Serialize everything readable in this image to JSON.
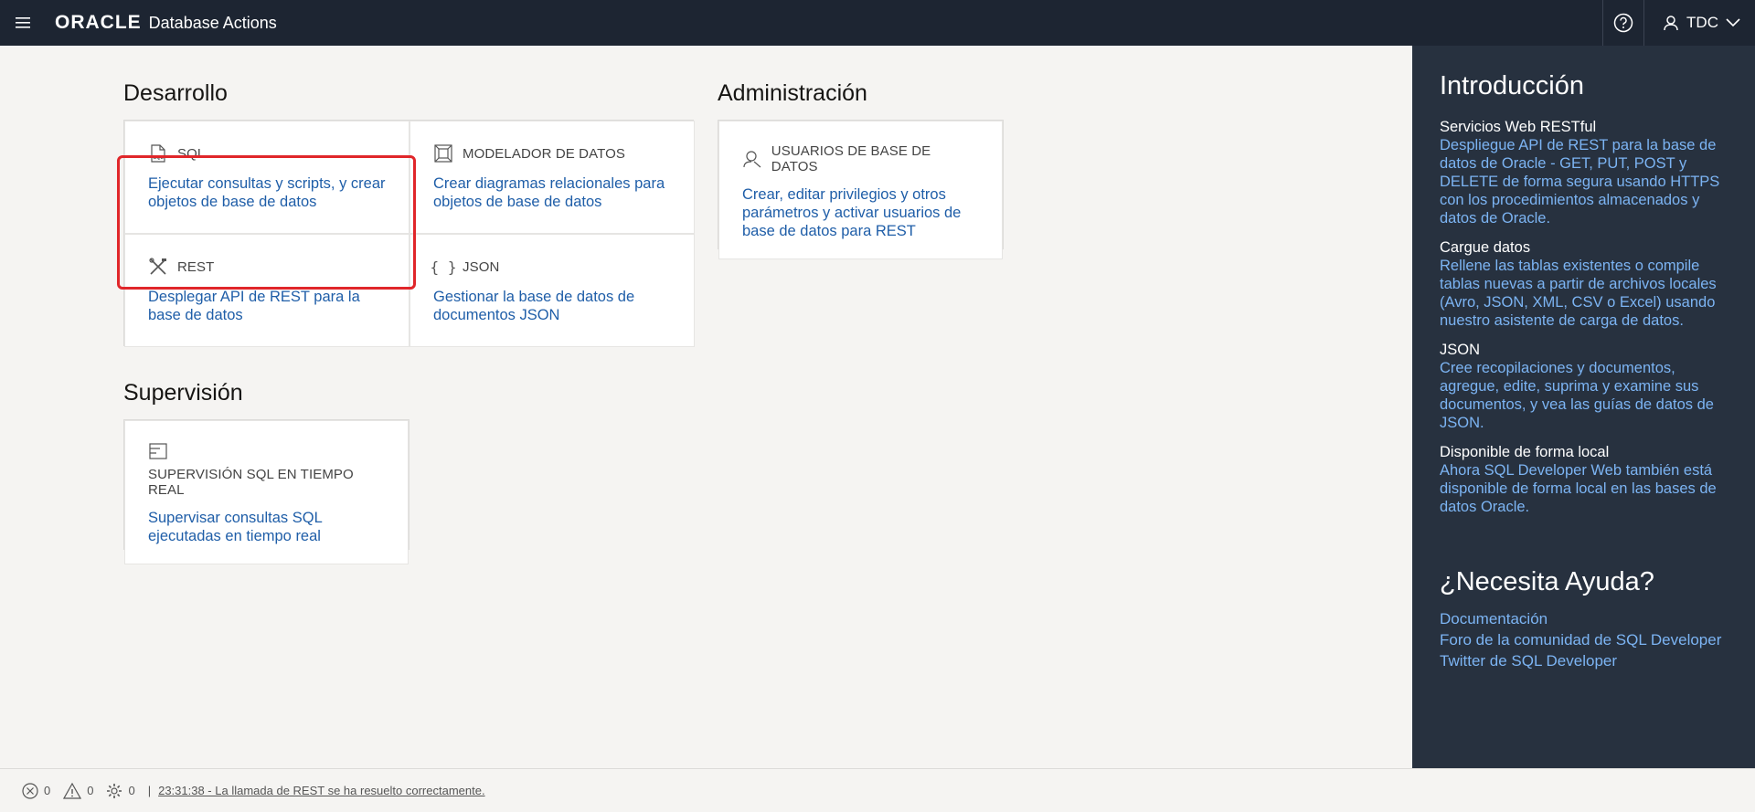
{
  "header": {
    "logo": "ORACLE",
    "app_name": "Database Actions",
    "user": "TDC"
  },
  "sections": {
    "dev": "Desarrollo",
    "admin": "Administración",
    "monitor": "Supervisión"
  },
  "cards": {
    "sql": {
      "title": "SQL",
      "desc": "Ejecutar consultas y scripts, y crear objetos de base de datos"
    },
    "modeler": {
      "title": "MODELADOR DE DATOS",
      "desc": "Crear diagramas relacionales para objetos de base de datos"
    },
    "rest": {
      "title": "REST",
      "desc": "Desplegar API de REST para la base de datos"
    },
    "json": {
      "title": "JSON",
      "desc": "Gestionar la base de datos de documentos JSON"
    },
    "users": {
      "title": "USUARIOS DE BASE DE DATOS",
      "desc": "Crear, editar privilegios y otros parámetros y activar usuarios de base de datos para REST"
    },
    "monitor": {
      "title": "SUPERVISIÓN SQL EN TIEMPO REAL",
      "desc": "Supervisar consultas SQL ejecutadas en tiempo real"
    }
  },
  "side": {
    "intro_title": "Introducción",
    "items": [
      {
        "title": "Servicios Web RESTful",
        "desc": "Despliegue API de REST para la base de datos de Oracle - GET, PUT, POST y DELETE de forma segura usando HTTPS con los procedimientos almacenados y datos de Oracle."
      },
      {
        "title": "Cargue datos",
        "desc": "Rellene las tablas existentes o compile tablas nuevas a partir de archivos locales (Avro, JSON, XML, CSV o Excel) usando nuestro asistente de carga de datos."
      },
      {
        "title": "JSON",
        "desc": "Cree recopilaciones y documentos, agregue, edite, suprima y examine sus documentos, y vea las guías de datos de JSON."
      },
      {
        "title": "Disponible de forma local",
        "desc": "Ahora SQL Developer Web también está disponible de forma local en las bases de datos Oracle."
      }
    ],
    "help_title": "¿Necesita Ayuda?",
    "links": [
      "Documentación",
      "Foro de la comunidad de SQL Developer",
      "Twitter de SQL Developer"
    ]
  },
  "status": {
    "errors": "0",
    "warnings": "0",
    "tasks": "0",
    "separator": "|",
    "message": "23:31:38 - La llamada de REST se ha resuelto correctamente."
  },
  "colors": {
    "header_bg": "#1d2532",
    "side_bg": "#27313f",
    "link": "#1f5ea8",
    "highlight": "#e0262a"
  }
}
